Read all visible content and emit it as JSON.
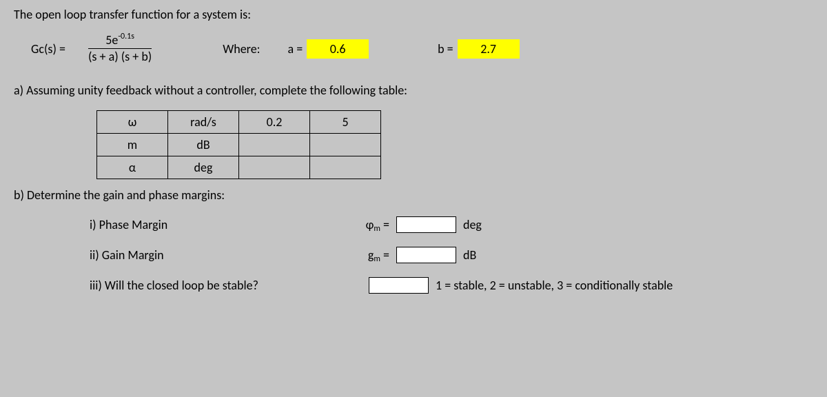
{
  "intro": "The open loop transfer function for a system is:",
  "eq": {
    "lhs": "Gc(s) =",
    "num_left": "5e",
    "num_sup": "-0.1s",
    "den": "(s + a) (s + b)",
    "where": "Where:",
    "a_lbl": "a =",
    "a_val": "0.6",
    "b_lbl": "b =",
    "b_val": "2.7"
  },
  "partA": "a) Assuming unity feedback without a controller, complete the following table:",
  "table": {
    "r0": {
      "c0": "ω",
      "c1": "rad/s",
      "c2": "0.2",
      "c3": "5"
    },
    "r1": {
      "c0": "m",
      "c1": "dB",
      "c2": "",
      "c3": ""
    },
    "r2": {
      "c0": "α",
      "c1": "deg",
      "c2": "",
      "c3": ""
    }
  },
  "partB": "b) Determine the gain and phase margins:",
  "margins": {
    "pm_lbl": "i) Phase Margin",
    "pm_sym": "ɸ",
    "pm_sub": "m",
    "pm_eq": "=",
    "pm_unit": "deg",
    "gm_lbl": "ii) Gain Margin",
    "gm_sym": "g",
    "gm_sub": "m",
    "gm_eq": "=",
    "gm_unit": "dB",
    "stab_lbl": "iii) Will the closed loop be stable?",
    "stab_hint": "1 = stable, 2 = unstable, 3 = conditionally stable"
  }
}
